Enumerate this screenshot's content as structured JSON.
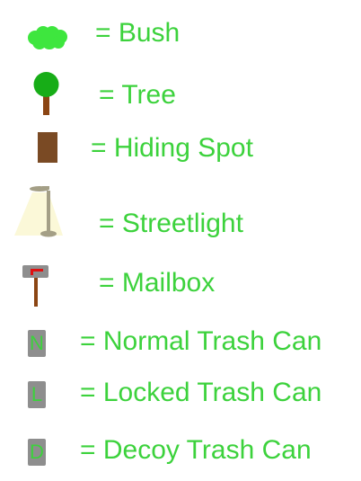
{
  "colors": {
    "label_green": "#3cd23c",
    "bush_green": "#3ee63e",
    "tree_green": "#17ad17",
    "trunk_brown": "#8b4513",
    "hiding_brown": "#7a4a24",
    "light_cone": "#fbf8d8",
    "pole_gray": "#a49f86",
    "can_gray": "#8e8e8e",
    "flag_red": "#e01010"
  },
  "legend": [
    {
      "id": "bush",
      "icon": "bush-icon",
      "label": "= Bush"
    },
    {
      "id": "tree",
      "icon": "tree-icon",
      "label": "= Tree"
    },
    {
      "id": "hiding",
      "icon": "hiding-spot-icon",
      "label": "= Hiding Spot"
    },
    {
      "id": "streetlight",
      "icon": "streetlight-icon",
      "label": "= Streetlight"
    },
    {
      "id": "mailbox",
      "icon": "mailbox-icon",
      "label": "= Mailbox"
    },
    {
      "id": "normal",
      "icon": "normal-trash-can-icon",
      "letter": "N",
      "label": "= Normal Trash Can"
    },
    {
      "id": "locked",
      "icon": "locked-trash-can-icon",
      "letter": "L",
      "label": "= Locked Trash Can"
    },
    {
      "id": "decoy",
      "icon": "decoy-trash-can-icon",
      "letter": "D",
      "label": "= Decoy Trash Can"
    }
  ]
}
